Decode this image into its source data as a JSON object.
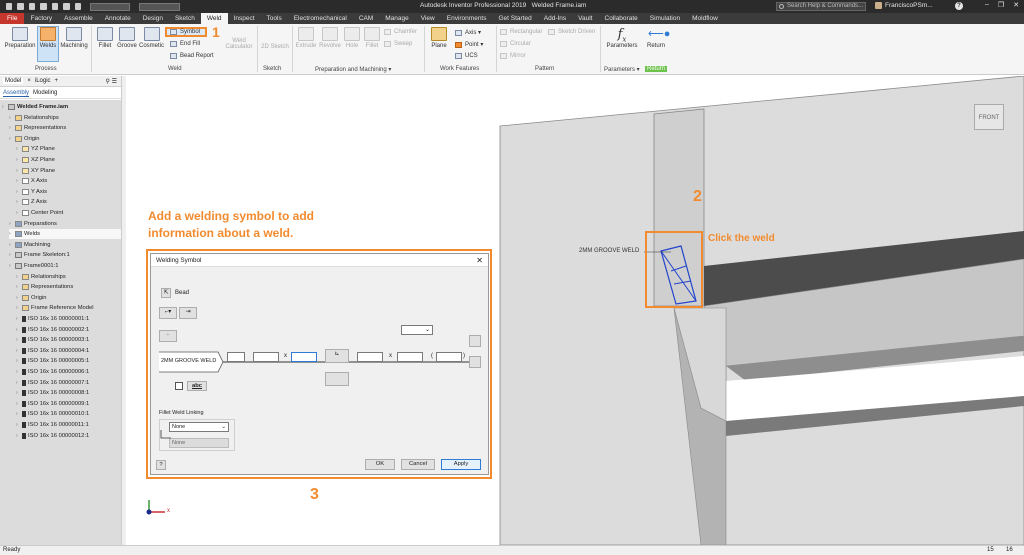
{
  "titlebar": {
    "app_title": "Autodesk Inventor Professional 2019",
    "file_title": "Welded Frame.iam",
    "search_placeholder": "Search Help & Commands...",
    "user_name": "FranciscoPSm...",
    "help_label": "?"
  },
  "menu_tabs": [
    "File",
    "Factory",
    "Assemble",
    "Annotate",
    "Design",
    "Sketch",
    "Weld",
    "Inspect",
    "Tools",
    "Electromechanical",
    "CAM",
    "Manage",
    "View",
    "Environments",
    "Get Started",
    "Add-Ins",
    "Vault",
    "Collaborate",
    "Simulation",
    "Moldflow"
  ],
  "ribbon": {
    "process": {
      "preparation": "Preparation",
      "welds": "Welds",
      "machining": "Machining",
      "label": "Process"
    },
    "weld": {
      "fillet": "Fillet",
      "groove": "Groove",
      "cosmetic": "Cosmetic",
      "symbol": "Symbol",
      "end_fill": "End Fill",
      "bead_report": "Bead Report",
      "weld_calculator": "Weld Calculator",
      "label": "Weld"
    },
    "sketch": {
      "sketch_2d": "2D Sketch",
      "label": "Sketch"
    },
    "prep_machining": {
      "extrude": "Extrude",
      "revolve": "Revolve",
      "hole": "Hole",
      "fillet": "Fillet",
      "chamfer": "Chamfer",
      "sweep": "Sweep",
      "label": "Preparation and Machining ▾"
    },
    "work_features": {
      "plane": "Plane",
      "axis": "Axis ▾",
      "point": "Point ▾",
      "ucs": "UCS",
      "label": "Work Features"
    },
    "pattern": {
      "rectangular": "Rectangular",
      "sketch_driven": "Sketch Driven",
      "circular": "Circular",
      "mirror": "Mirror",
      "label": "Pattern"
    },
    "parameters": {
      "parameters": "Parameters",
      "return": "Return",
      "label": "Parameters ▾",
      "return_label": "Return"
    }
  },
  "callouts": {
    "num1": "1",
    "num2": "2",
    "num3": "3",
    "add_symbol_note": "Add a welding symbol to add information about a weld.",
    "click_weld": "Click the weld"
  },
  "browser": {
    "tab_model": "Model",
    "tab_close": "×",
    "tab_ilogic": "iLogic",
    "tab_add": "+",
    "sub_assembly": "Assembly",
    "sub_modeling": "Modeling",
    "items": [
      {
        "label": "Welded Frame.iam",
        "level": 0,
        "bold": true
      },
      {
        "label": "Relationships",
        "level": 1
      },
      {
        "label": "Representations",
        "level": 1
      },
      {
        "label": "Origin",
        "level": 1
      },
      {
        "label": "YZ Plane",
        "level": 2
      },
      {
        "label": "XZ Plane",
        "level": 2
      },
      {
        "label": "XY Plane",
        "level": 2
      },
      {
        "label": "X Axis",
        "level": 2
      },
      {
        "label": "Y Axis",
        "level": 2
      },
      {
        "label": "Z Axis",
        "level": 2
      },
      {
        "label": "Center Point",
        "level": 2
      },
      {
        "label": "Preparations",
        "level": 1
      },
      {
        "label": "Welds",
        "level": 1,
        "highlight": true
      },
      {
        "label": "Machining",
        "level": 1
      },
      {
        "label": "Frame Skeleton:1",
        "level": 1
      },
      {
        "label": "Frame0001:1",
        "level": 1
      },
      {
        "label": "Relationships",
        "level": 2
      },
      {
        "label": "Representations",
        "level": 2
      },
      {
        "label": "Origin",
        "level": 2
      },
      {
        "label": "Frame Reference Model",
        "level": 2
      },
      {
        "label": "ISO 16x 16 00000001:1",
        "level": 2
      },
      {
        "label": "ISO 16x 16 00000002:1",
        "level": 2
      },
      {
        "label": "ISO 16x 16 00000003:1",
        "level": 2
      },
      {
        "label": "ISO 16x 16 00000004:1",
        "level": 2
      },
      {
        "label": "ISO 16x 16 00000005:1",
        "level": 2
      },
      {
        "label": "ISO 16x 16 00000006:1",
        "level": 2
      },
      {
        "label": "ISO 16x 16 00000007:1",
        "level": 2
      },
      {
        "label": "ISO 16x 16 00000008:1",
        "level": 2
      },
      {
        "label": "ISO 16x 16 00000009:1",
        "level": 2
      },
      {
        "label": "ISO 16x 16 00000010:1",
        "level": 2
      },
      {
        "label": "ISO 16x 16 00000011:1",
        "level": 2
      },
      {
        "label": "ISO 16x 16 00000012:1",
        "level": 2
      }
    ]
  },
  "viewport": {
    "viewcube": "FRONT",
    "weld_label": "2MM GROOVE WELD",
    "triad_x": "x"
  },
  "dialog": {
    "title": "Welding Symbol",
    "bead_label": "Bead",
    "weld_text": "2MM GROOVE WELD",
    "x1": "x",
    "x2": "x",
    "paren_open": "(",
    "paren_close": ")",
    "abc": "abc",
    "fillet_linking_label": "Fillet Weld Linking",
    "fillet_select": "None",
    "fillet_field": "None",
    "ok": "OK",
    "cancel": "Cancel",
    "apply": "Apply"
  },
  "status": {
    "text": "Ready",
    "n1": "15",
    "n2": "16"
  }
}
